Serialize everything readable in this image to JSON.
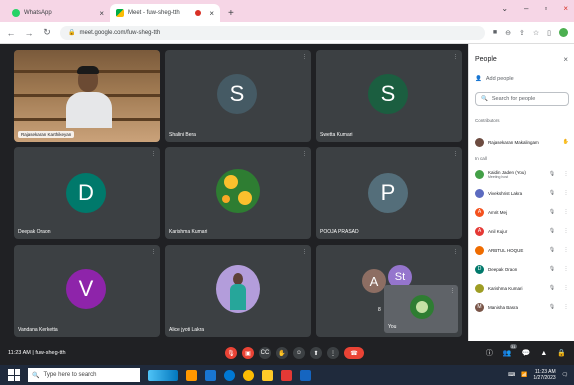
{
  "browser": {
    "tabs": [
      {
        "title": "WhatsApp",
        "active": false
      },
      {
        "title": "Meet - fuw-sheg-tth",
        "active": true
      }
    ],
    "url": "meet.google.com/fuw-sheg-tth"
  },
  "meet": {
    "time_label": "11:23 AM",
    "meeting_code": "fuw-sheg-tth",
    "participant_count_badge": "31",
    "tiles": [
      {
        "name": "Rajasekaran Karthikeyan",
        "type": "video"
      },
      {
        "name": "Shalini Bera",
        "initial": "S",
        "color": "#455a64"
      },
      {
        "name": "Swetta Kumari",
        "initial": "S",
        "color": "#1b5e40"
      },
      {
        "name": "Deepak Oraon",
        "initial": "D",
        "color": "#00796b"
      },
      {
        "name": "Karishma Kumari",
        "type": "flower"
      },
      {
        "name": "POOJA PRASAD",
        "initial": "P",
        "color": "#546e7a"
      },
      {
        "name": "Vandana Kerketta",
        "initial": "V",
        "color": "#8e24aa"
      },
      {
        "name": "Alice jyoti Lakra",
        "type": "photo"
      }
    ],
    "grouped_tile": {
      "initials": [
        "A",
        "St"
      ],
      "colors": [
        "#8d6e63",
        "#9575cd"
      ],
      "extra": "8"
    },
    "self_view": {
      "name": "You"
    }
  },
  "people_panel": {
    "title": "People",
    "add_people": "Add people",
    "search_placeholder": "Search for people",
    "section_contributors": "Contributors",
    "host": {
      "name": "Rajasekaran Makalingam",
      "color": "#6d4c41"
    },
    "section_in_call": "In call",
    "participants": [
      {
        "name": "Kaidin Jaden (You)",
        "sub": "Meeting host",
        "color": "#43a047",
        "initial": ""
      },
      {
        "name": "Vivekshrist Lakra",
        "sub": "",
        "color": "#5c6bc0",
        "initial": ""
      },
      {
        "name": "Amrit Mej",
        "sub": "",
        "color": "#f4511e",
        "initial": "A"
      },
      {
        "name": "Anil Kujur",
        "sub": "",
        "color": "#e53935",
        "initial": "A"
      },
      {
        "name": "ARBTUL HOQUE",
        "sub": "",
        "color": "#ef6c00",
        "initial": ""
      },
      {
        "name": "Deepak Oraon",
        "sub": "",
        "color": "#00796b",
        "initial": "D"
      },
      {
        "name": "Karishma Kumari",
        "sub": "",
        "color": "#9e9d24",
        "initial": ""
      },
      {
        "name": "Manisha Basra",
        "sub": "",
        "color": "#795548",
        "initial": "M"
      }
    ]
  },
  "taskbar": {
    "search_placeholder": "Type here to search",
    "time": "11:23 AM",
    "date": "1/27/2023"
  }
}
